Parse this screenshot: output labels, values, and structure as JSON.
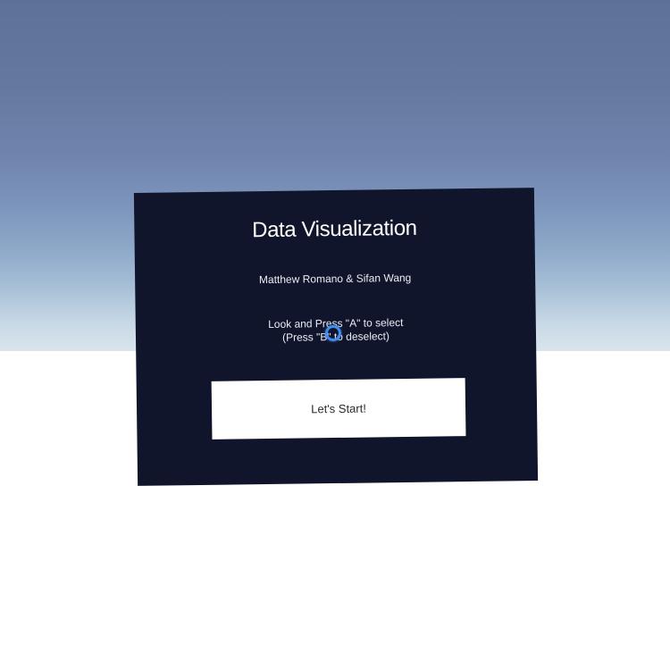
{
  "panel": {
    "title": "Data Visualization",
    "authors": "Matthew Romano & Sifan Wang",
    "instructions": [
      "Look and Press \"A\" to select",
      "(Press \"B\" to deselect)"
    ],
    "start_button_label": "Let's Start!"
  },
  "colors": {
    "sky_top": "#5d7299",
    "horizon": "#dbe6ee",
    "ground": "#ffffff",
    "panel_background": "#10152b",
    "button_background": "#ffffff",
    "reticle": "#3f8df0"
  },
  "icons": {
    "reticle": "gaze-reticle-ring"
  }
}
